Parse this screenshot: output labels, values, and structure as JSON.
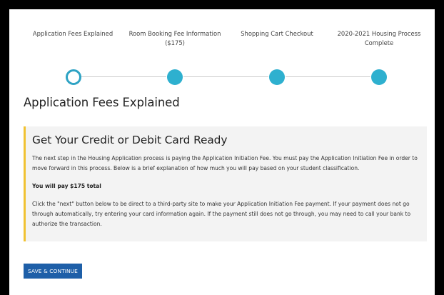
{
  "steps": [
    {
      "label": "Application Fees Explained",
      "status": "current"
    },
    {
      "label": "Room Booking Fee Information ($175)",
      "status": "upcoming"
    },
    {
      "label": "Shopping Cart Checkout",
      "status": "upcoming"
    },
    {
      "label": "2020-2021 Housing Process Complete",
      "status": "upcoming"
    }
  ],
  "page": {
    "title": "Application Fees Explained"
  },
  "notice": {
    "heading": "Get Your Credit or Debit Card Ready",
    "paragraph1": "The next step in the Housing Application process is paying the Application Initiation Fee. You must pay the Application Initiation Fee in order to move forward in this process. Below is a brief explanation of how much you will pay based on your student classification.",
    "paragraph2": "You will pay $175 total",
    "paragraph3": "Click the \"next\" button below to be direct to a third-party site to make your Application Initiation Fee payment. If your payment does not go through automatically, try entering your card information again. If the payment still does not go through, you may need to call your bank to authorize the transaction."
  },
  "actions": {
    "save_continue_label": "SAVE & CONTINUE"
  },
  "colors": {
    "accent": "#2eb0cf",
    "notice_border": "#f1c232",
    "button": "#1e5fa8"
  }
}
